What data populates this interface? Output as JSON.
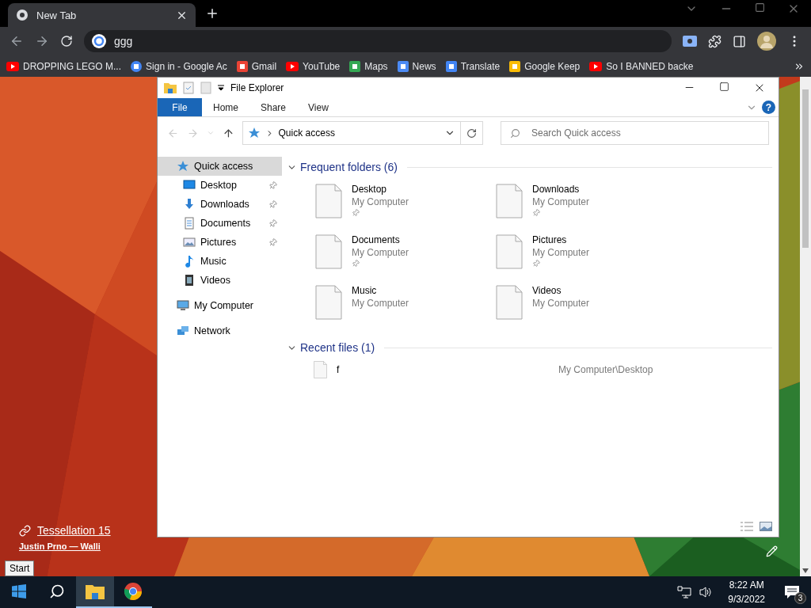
{
  "browser": {
    "tabs": [
      {
        "title": "New Tab",
        "selected": true
      }
    ],
    "address": "ggg",
    "bookmarks": [
      {
        "label": "DROPPING LEGO M...",
        "kind": "youtube"
      },
      {
        "label": "Sign in - Google Ac",
        "kind": "google"
      },
      {
        "label": "Gmail",
        "kind": "gmail"
      },
      {
        "label": "YouTube",
        "kind": "youtube"
      },
      {
        "label": "Maps",
        "kind": "maps"
      },
      {
        "label": "News",
        "kind": "news"
      },
      {
        "label": "Translate",
        "kind": "translate"
      },
      {
        "label": "Google Keep",
        "kind": "keep"
      },
      {
        "label": "So I BANNED backe",
        "kind": "youtube"
      }
    ]
  },
  "explorer": {
    "title": "File Explorer",
    "ribbon_tabs": [
      {
        "label": "File",
        "selected": true
      },
      {
        "label": "Home",
        "selected": false
      },
      {
        "label": "Share",
        "selected": false
      },
      {
        "label": "View",
        "selected": false
      }
    ],
    "help": "?",
    "location": "Quick access",
    "search": {
      "placeholder": "Search Quick access"
    },
    "nav": [
      {
        "label": "Quick access",
        "kind": "star",
        "selected": true,
        "children": [
          {
            "label": "Desktop",
            "kind": "desktop",
            "selected": false,
            "pinned": true
          },
          {
            "label": "Downloads",
            "kind": "downloads",
            "selected": false,
            "pinned": true
          },
          {
            "label": "Documents",
            "kind": "documents",
            "selected": false,
            "pinned": true
          },
          {
            "label": "Pictures",
            "kind": "pictures",
            "selected": false,
            "pinned": true
          },
          {
            "label": "Music",
            "kind": "music",
            "selected": false,
            "pinned": false
          },
          {
            "label": "Videos",
            "kind": "videos",
            "selected": false,
            "pinned": false
          }
        ]
      },
      {
        "label": "My Computer",
        "kind": "computer",
        "selected": false
      },
      {
        "label": "Network",
        "kind": "network",
        "selected": false
      }
    ],
    "sections": [
      {
        "title": "Frequent folders (6)",
        "kind": "folders",
        "expanded": true,
        "items": [
          {
            "name": "Desktop",
            "location": "My Computer",
            "pinned": true
          },
          {
            "name": "Downloads",
            "location": "My Computer",
            "pinned": true
          },
          {
            "name": "Documents",
            "location": "My Computer",
            "pinned": true
          },
          {
            "name": "Pictures",
            "location": "My Computer",
            "pinned": true
          },
          {
            "name": "Music",
            "location": "My Computer",
            "pinned": false
          },
          {
            "name": "Videos",
            "location": "My Computer",
            "pinned": false
          }
        ]
      },
      {
        "title": "Recent files (1)",
        "kind": "files",
        "expanded": true,
        "items": [
          {
            "name": "f",
            "location": "My Computer\\Desktop"
          }
        ]
      }
    ]
  },
  "desktop": {
    "attribution": {
      "title": "Tessellation 15",
      "author": "Justin Prno — Walli"
    },
    "tooltip": "Start"
  },
  "taskbar": {
    "apps": [
      {
        "kind": "start",
        "active": false
      },
      {
        "kind": "search",
        "active": false
      },
      {
        "kind": "explorer",
        "active": true
      },
      {
        "kind": "chrome",
        "active": false
      }
    ],
    "time": "8:22 AM",
    "date": "9/3/2022",
    "notifications": "3"
  }
}
